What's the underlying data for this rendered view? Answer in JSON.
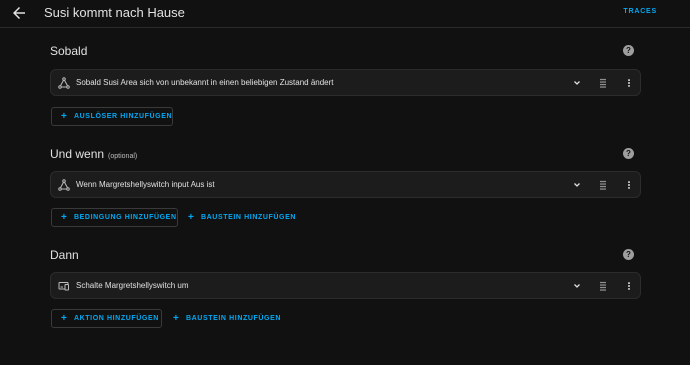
{
  "header": {
    "title": "Susi kommt nach Hause",
    "traces_label": "TRACES"
  },
  "sections": {
    "triggers": {
      "title": "Sobald",
      "item_text": "Sobald Susi Area sich von unbekannt in einen beliebigen Zustand ändert",
      "add_label": "AUSLÖSER HINZUFÜGEN"
    },
    "conditions": {
      "title": "Und wenn",
      "optional": "(optional)",
      "item_text": "Wenn Margretshellyswitch input Aus ist",
      "add_label": "BEDINGUNG HINZUFÜGEN",
      "building_block_label": "BAUSTEIN HINZUFÜGEN"
    },
    "actions": {
      "title": "Dann",
      "item_text": "Schalte Margretshellyswitch um",
      "add_label": "AKTION HINZUFÜGEN",
      "building_block_label": "BAUSTEIN HINZUFÜGEN"
    }
  },
  "icons": {
    "back": "arrow-left-icon",
    "help": "help-circle-icon",
    "trigger": "graph-node-icon",
    "condition": "graph-node-icon",
    "action": "device-icon",
    "expand": "chevron-down-icon",
    "drag": "drag-handle-icon",
    "menu": "dots-vertical-icon"
  },
  "colors": {
    "background": "#111111",
    "card": "#1c1c1c",
    "accent": "#03a9f4",
    "text": "#e1e1e1"
  }
}
